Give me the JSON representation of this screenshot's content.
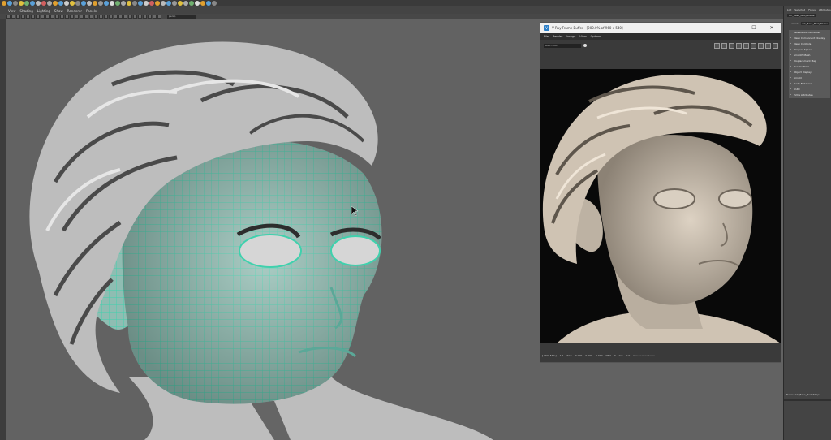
{
  "menubar": [
    "View",
    "Shading",
    "Lighting",
    "Show",
    "Renderer",
    "Panels"
  ],
  "camera_field": "persp",
  "vfb": {
    "title": "V-Ray Frame Buffer - [200.0% of 960 x 540]",
    "menu": [
      "File",
      "Render",
      "Image",
      "View",
      "Options"
    ],
    "channel": "RGB color",
    "window_buttons": [
      "—",
      "☐",
      "✕"
    ],
    "status": {
      "coords": "[ 960, 540 ]",
      "ratio": "1:1",
      "mode": "Raw",
      "r": "0.000",
      "g": "0.000",
      "b": "0.000",
      "hsv": "HSV",
      "values": [
        "0",
        "0.0",
        "0.0"
      ],
      "note": "Finished render in ..."
    }
  },
  "attr": {
    "tabs": [
      "List",
      "Selected",
      "Focus",
      "Attributes"
    ],
    "node_label": "mesh:",
    "node_value": "CC_Base_BodyShape",
    "sections": [
      "Tessellation Attributes",
      "Mesh Component Display",
      "Mesh Controls",
      "Tangent Space",
      "Smooth Mesh",
      "Displacement Map",
      "Render Stats",
      "Object Display",
      "Arnold",
      "Node Behavior",
      "UUID",
      "Extra Attributes"
    ],
    "bottom_label": "Notes: CC_Base_BodyShape"
  },
  "colors": {
    "viewport_bg": "#626262",
    "wire": "#3fd1ad",
    "clay": "#c9c9c9",
    "render_bg": "#090909",
    "render_skin": "#cfc3b3"
  }
}
